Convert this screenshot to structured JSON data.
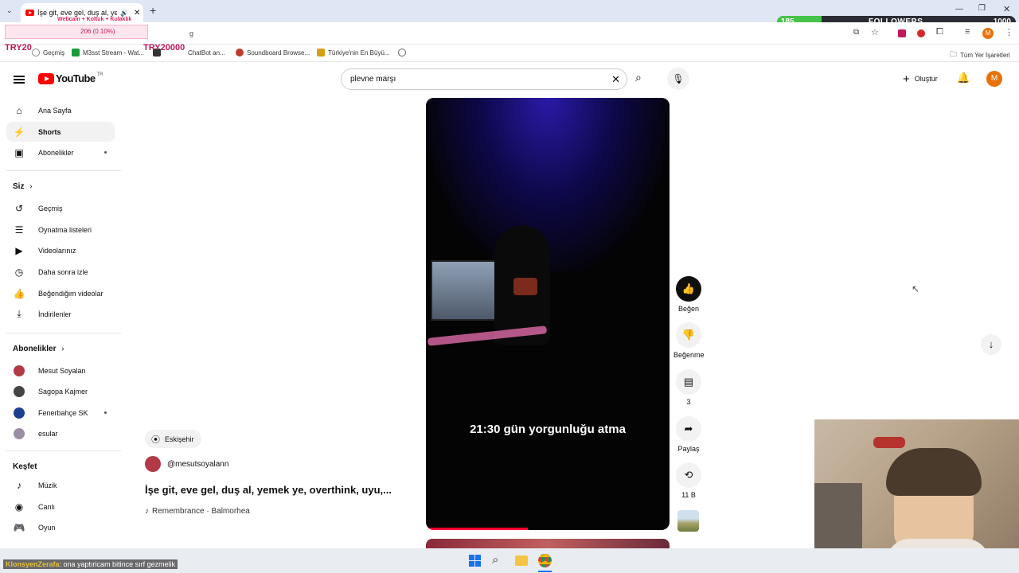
{
  "browser": {
    "tab_title": "İşe git, eve gel, duş al, yem",
    "stream_overlay_text": "Webcam + Koltuk + Kulaklık",
    "overlay_progress_text": "206 (0.10%)",
    "address_fragment": "g",
    "overlay_left": "TRY20",
    "overlay_center": "TRY20000",
    "bookmarks": [
      "Geçmiş",
      "M3sst Stream - Wat...",
      "ChatBot an...",
      "Soundboard Browse...",
      "Türkiye'nin En Büyü..."
    ],
    "all_bookmarks_label": "Tüm Yer İşaretleri",
    "followers": {
      "current": "185",
      "label": "FOLLOWERS",
      "goal": "1000",
      "progress": 0.185
    },
    "profile_initial": "M"
  },
  "header": {
    "logo_text": "YouTube",
    "logo_country": "TR",
    "search_value": "plevne marşı",
    "create_label": "Oluştur",
    "avatar_initial": "M"
  },
  "sidebar": {
    "main": [
      {
        "label": "Ana Sayfa",
        "icon": "home-icon"
      },
      {
        "label": "Shorts",
        "icon": "shorts-icon"
      },
      {
        "label": "Abonelikler",
        "icon": "subscriptions-icon"
      }
    ],
    "you_heading": "Siz",
    "you": [
      {
        "label": "Geçmiş",
        "icon": "history-icon"
      },
      {
        "label": "Oynatma listeleri",
        "icon": "playlist-icon"
      },
      {
        "label": "Videolarınız",
        "icon": "your-videos-icon"
      },
      {
        "label": "Daha sonra izle",
        "icon": "watch-later-icon"
      },
      {
        "label": "Beğendiğim videolar",
        "icon": "liked-icon"
      },
      {
        "label": "İndirilenler",
        "icon": "download-icon"
      }
    ],
    "subs_heading": "Abonelikler",
    "subs": [
      {
        "label": "Mesut Soyalan",
        "color": "#b23a48"
      },
      {
        "label": "Sagopa Kajmer",
        "color": "#444444"
      },
      {
        "label": "Fenerbahçe SK",
        "color": "#1d3f8f"
      },
      {
        "label": "esular",
        "color": "#9a8fa6"
      }
    ],
    "explore_heading": "Keşfet",
    "explore": [
      {
        "label": "Müzik",
        "icon": "music-icon"
      },
      {
        "label": "Canlı",
        "icon": "live-icon"
      },
      {
        "label": "Oyun",
        "icon": "gaming-icon"
      }
    ]
  },
  "short": {
    "location": "Eskişehir",
    "channel": "@mesutsoyalann",
    "title": "İşe git, eve gel, duş al, yemek ye, overthink, uyu,...",
    "music": "Remembrance · Balmorhea",
    "caption": "21:30 gün yorgunluğu atma",
    "actions": {
      "like": "Beğen",
      "dislike": "Beğenme",
      "comments": "3",
      "share": "Paylaş",
      "remix": "11 B"
    }
  },
  "chat_overlay": {
    "user": "KlonsyenZerafa",
    "message": ": ona yaptıricam bitince sırf gezmelik"
  }
}
